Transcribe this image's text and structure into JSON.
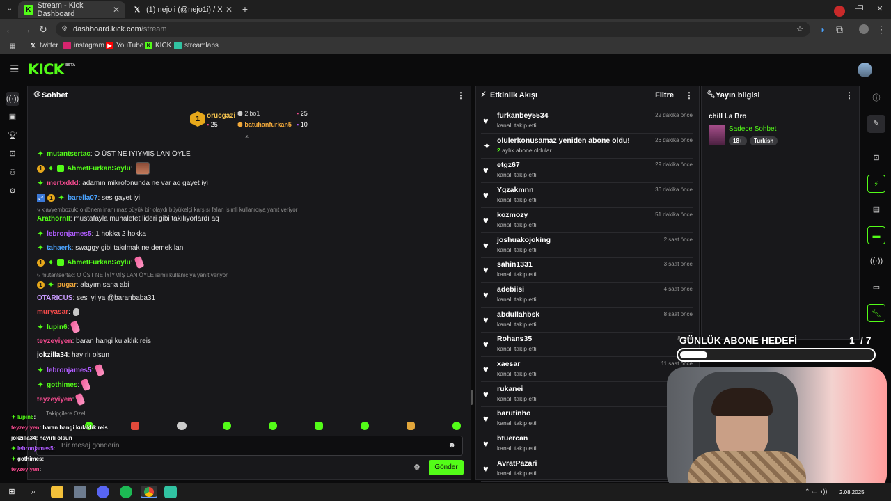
{
  "browser": {
    "tabs": [
      {
        "label": "Stream - Kick Dashboard",
        "icon": "kick-icon"
      },
      {
        "label": "(1) nejoli (@nejo1i) / X",
        "icon": "x-icon"
      }
    ],
    "url_host": "dashboard.kick.com",
    "url_path": "/stream",
    "bookmarks": [
      "twitter",
      "instagram",
      "YouTube",
      "KICK",
      "streamlabs"
    ]
  },
  "header": {
    "logo": "KICK",
    "logo_badge": "BETA"
  },
  "chat": {
    "title": "Sohbet",
    "leaderboard": {
      "first": {
        "rank": "1",
        "name": "orucgazi",
        "count": "25"
      },
      "second": {
        "name": "2ibo1",
        "count": "25"
      },
      "third": {
        "name": "batuhanfurkan5",
        "count": "10"
      }
    },
    "messages": [
      {
        "user": "mutantsertac",
        "color": "#53fc18",
        "text": ": O ÜST NE İYİYMİŞ LAN ÖYLE"
      },
      {
        "user": "AhmetFurkanSoylu",
        "color": "#53fc18",
        "text": ":"
      },
      {
        "user": "mertxddd",
        "color": "#f54b8f",
        "text": ": adamın mikrofonunda ne var aq gayet iyi"
      },
      {
        "user": "barella07",
        "color": "#4aa3ff",
        "text": ": ses gayet iyi"
      },
      {
        "reply": "klavyembozuk: o dönem inanılmaz büyük bir olaydı büyükelçi karşısı falan isimli kullanıcıya yanıt veriyor"
      },
      {
        "user": "ArathornII",
        "color": "#53fc18",
        "text": ": mustafayla muhalefet lideri gibi takılıyorlardı aq"
      },
      {
        "user": "lebronjames5",
        "color": "#b05cff",
        "text": ": 1 hokka 2 hokka"
      },
      {
        "user": "tahaerk",
        "color": "#4aa3ff",
        "text": ": swaggy gibi takılmak ne demek lan"
      },
      {
        "user": "AhmetFurkanSoylu",
        "color": "#53fc18",
        "text": ":"
      },
      {
        "reply": "mutantsertac: O ÜST NE İYİYMİŞ LAN ÖYLE isimli kullanıcıya yanıt veriyor"
      },
      {
        "user": "pugar",
        "color": "#f2a93b",
        "text": ": alayım sana abi"
      },
      {
        "user": "OTARICUS",
        "color": "#c99bff",
        "text": ": ses iyi ya @baranbaba31"
      },
      {
        "user": "muryasar",
        "color": "#f54b4b",
        "text": ":"
      },
      {
        "user": "lupin6",
        "color": "#53fc18",
        "text": ":"
      },
      {
        "user": "teyzeyiyen",
        "color": "#f54b8f",
        "text": ": baran hangi kulaklık reis"
      },
      {
        "user": "jokzilla34",
        "color": "#ffffff",
        "text": ": hayırlı olsun"
      },
      {
        "user": "lebronjames5",
        "color": "#b05cff",
        "text": ":"
      },
      {
        "user": "gothimes",
        "color": "#53fc18",
        "text": ":"
      },
      {
        "user": "teyzeyiyen",
        "color": "#f54b8f",
        "text": ":"
      }
    ],
    "followers_only": "Takipçilere Özel",
    "input_placeholder": "Bir mesaj gönderin",
    "send_label": "Gönder"
  },
  "overlay_chat": [
    {
      "user": "lupin6",
      "text": ":"
    },
    {
      "user": "teyzeyiyen",
      "text": ": baran hangi kulaklık reis"
    },
    {
      "user": "jokzilla34",
      "text": ": hayırlı olsun"
    },
    {
      "user": "lebronjames5",
      "text": ":"
    },
    {
      "user": "gothimes",
      "text": ":"
    },
    {
      "user": "teyzeyiyen",
      "text": ":"
    }
  ],
  "activity": {
    "title": "Etkinlik Akışı",
    "filter_label": "Filtre",
    "events": [
      {
        "name": "furkanbey5534",
        "sub": "kanalı takip etti",
        "time": "22 dakika önce"
      },
      {
        "name": "olulerkonusamaz yeniden abone oldu!",
        "sub_count": "2",
        "sub": "aylık abone oldular",
        "time": "26 dakika önce",
        "type": "sub"
      },
      {
        "name": "etgz67",
        "sub": "kanalı takip etti",
        "time": "29 dakika önce"
      },
      {
        "name": "Ygzakmnn",
        "sub": "kanalı takip etti",
        "time": "36 dakika önce"
      },
      {
        "name": "kozmozy",
        "sub": "kanalı takip etti",
        "time": "51 dakika önce"
      },
      {
        "name": "joshuakojoking",
        "sub": "kanalı takip etti",
        "time": "2 saat önce"
      },
      {
        "name": "sahin1331",
        "sub": "kanalı takip etti",
        "time": "3 saat önce"
      },
      {
        "name": "adebiisi",
        "sub": "kanalı takip etti",
        "time": "4 saat önce"
      },
      {
        "name": "abdullahbsk",
        "sub": "kanalı takip etti",
        "time": "8 saat önce"
      },
      {
        "name": "Rohans35",
        "sub": "kanalı takip etti",
        "time": "8 saat"
      },
      {
        "name": "xaesar",
        "sub": "kanalı takip etti",
        "time": "11 saat önce"
      },
      {
        "name": "rukanei",
        "sub": "kanalı takip etti",
        "time": "15"
      },
      {
        "name": "barutinho",
        "sub": "kanalı takip etti",
        "time": "15"
      },
      {
        "name": "btuercan",
        "sub": "kanalı takip etti",
        "time": "18"
      },
      {
        "name": "AvratPazari",
        "sub": "kanalı takip etti",
        "time": "19"
      }
    ]
  },
  "stream_info": {
    "title": "Yayın bilgisi",
    "stream_title": "chill La Bro",
    "category": "Sadece Sohbet",
    "tags": [
      "18+",
      "Turkish"
    ]
  },
  "sub_goal": {
    "label": "GÜNLÜK ABONE HEDEFİ",
    "current": "1",
    "target": "/ 7",
    "progress": 0.14
  },
  "taskbar": {
    "date": "2.08.2025"
  },
  "colors": {
    "kick_green": "#53fc18",
    "panel": "#18181b",
    "background": "#0b0b0c"
  }
}
